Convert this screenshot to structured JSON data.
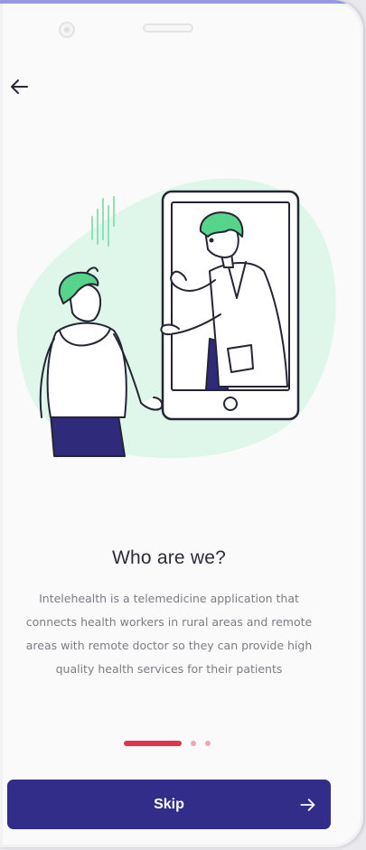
{
  "onboarding": {
    "title": "Who are we?",
    "description": "Intelehealth is a telemedicine application that connects health workers in rural areas and remote areas with remote doctor so they can provide high quality health services for their patients",
    "pager": {
      "total": 3,
      "current": 1
    },
    "skip_label": "Skip"
  },
  "icons": {
    "back": "arrow-left-icon",
    "skip": "arrow-right-icon"
  },
  "colors": {
    "primary": "#332d8a",
    "accent": "#e3344f",
    "accent_light": "#f2a7b3",
    "illustration_bg": "#dff6ea",
    "illustration_green": "#56d48c",
    "illustration_navy": "#2f2a7a",
    "outline": "#252534"
  }
}
